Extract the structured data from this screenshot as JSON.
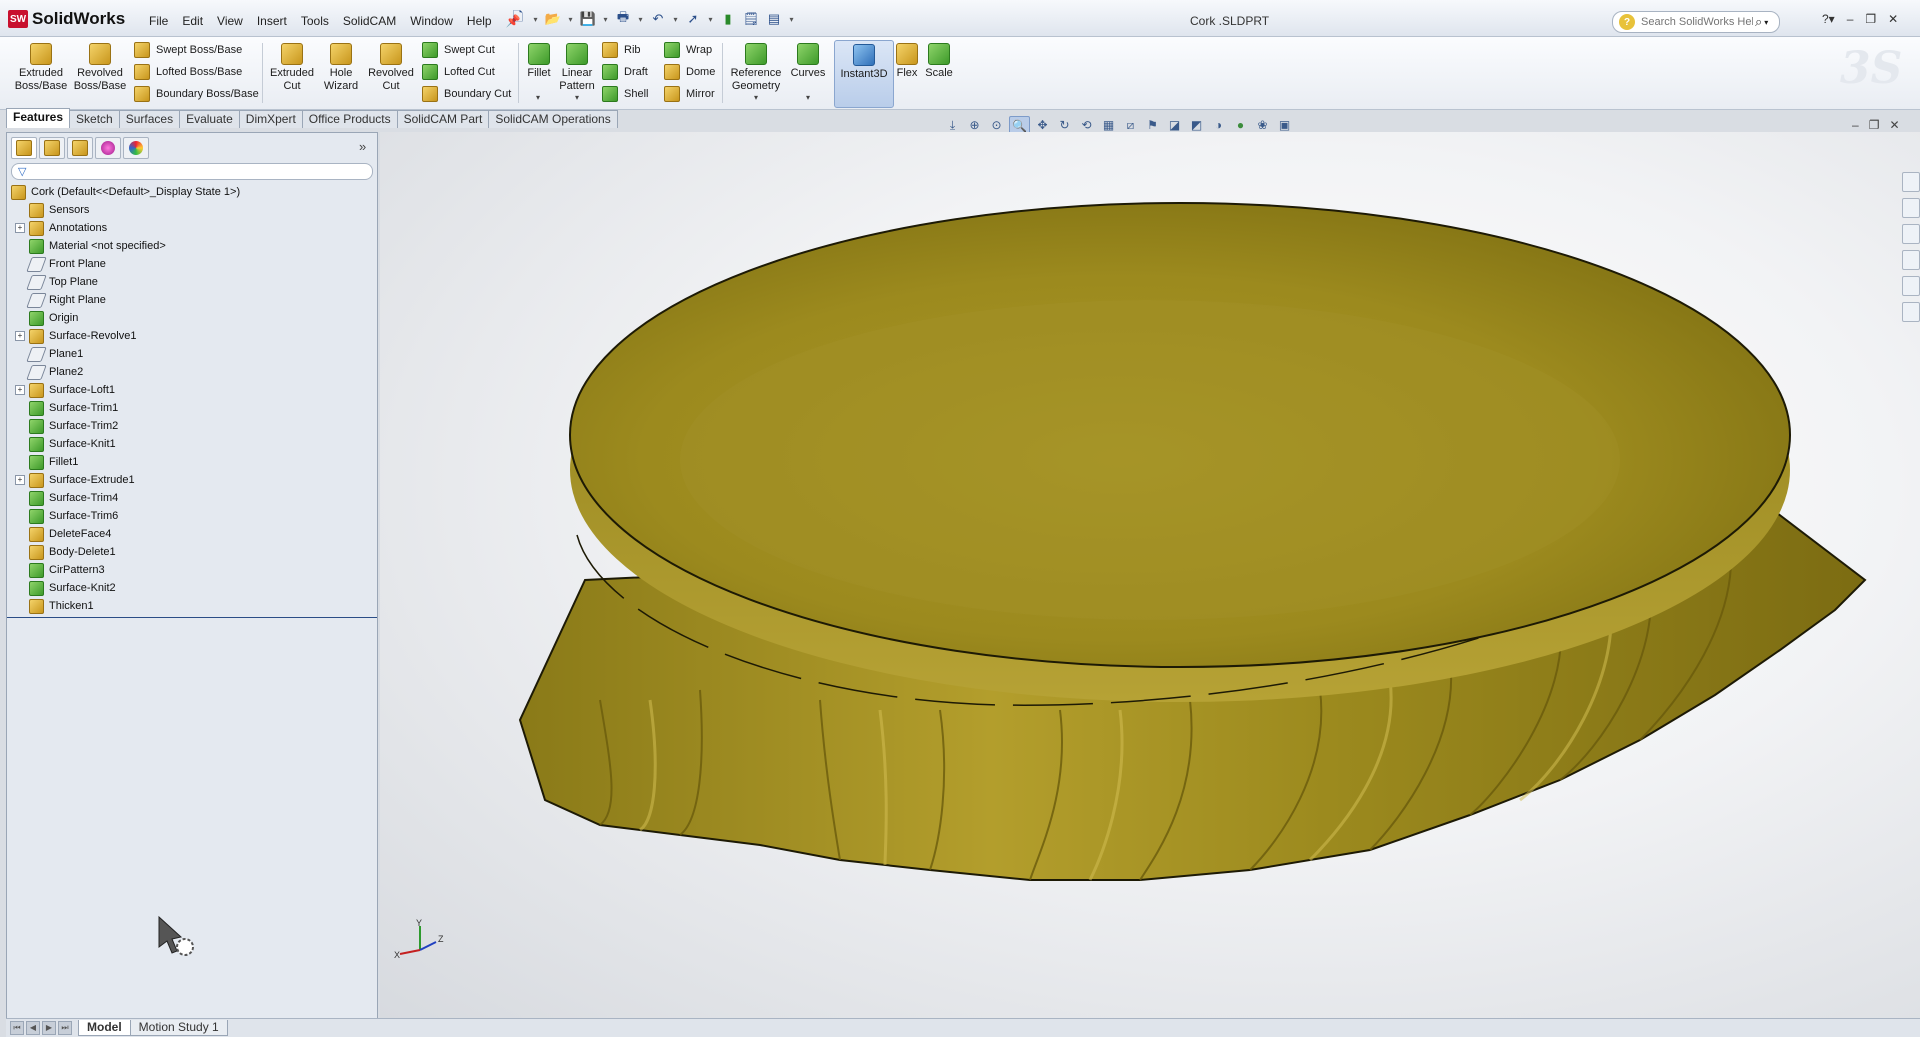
{
  "app": {
    "brand": "SolidWorks",
    "brand_logo": "SW",
    "document_title": "Cork .SLDPRT"
  },
  "menu": [
    "File",
    "Edit",
    "View",
    "Insert",
    "Tools",
    "SolidCAM",
    "Window",
    "Help"
  ],
  "search": {
    "placeholder": "Search SolidWorks Help"
  },
  "toolbar": {
    "extruded_boss": "Extruded Boss/Base",
    "revolved_boss": "Revolved Boss/Base",
    "swept_boss": "Swept Boss/Base",
    "lofted_boss": "Lofted Boss/Base",
    "boundary_boss": "Boundary Boss/Base",
    "extruded_cut": "Extruded Cut",
    "hole_wizard": "Hole Wizard",
    "revolved_cut": "Revolved Cut",
    "swept_cut": "Swept Cut",
    "lofted_cut": "Lofted Cut",
    "boundary_cut": "Boundary Cut",
    "fillet": "Fillet",
    "linear_pattern": "Linear Pattern",
    "rib": "Rib",
    "draft": "Draft",
    "shell": "Shell",
    "wrap": "Wrap",
    "dome": "Dome",
    "mirror": "Mirror",
    "reference_geometry": "Reference Geometry",
    "curves": "Curves",
    "instant3d": "Instant3D",
    "flex": "Flex",
    "scale": "Scale"
  },
  "tabs": [
    "Features",
    "Sketch",
    "Surfaces",
    "Evaluate",
    "DimXpert",
    "Office Products",
    "SolidCAM Part",
    "SolidCAM Operations"
  ],
  "tree": {
    "root": "Cork  (Default<<Default>_Display State 1>)",
    "items": [
      {
        "label": "Sensors",
        "expandable": false,
        "icon": "sensor-icon"
      },
      {
        "label": "Annotations",
        "expandable": true,
        "icon": "annotation-icon"
      },
      {
        "label": "Material <not specified>",
        "expandable": false,
        "icon": "material-icon"
      },
      {
        "label": "Front Plane",
        "expandable": false,
        "icon": "plane-icon"
      },
      {
        "label": "Top Plane",
        "expandable": false,
        "icon": "plane-icon"
      },
      {
        "label": "Right Plane",
        "expandable": false,
        "icon": "plane-icon"
      },
      {
        "label": "Origin",
        "expandable": false,
        "icon": "origin-icon"
      },
      {
        "label": "Surface-Revolve1",
        "expandable": true,
        "icon": "surface-revolve-icon"
      },
      {
        "label": "Plane1",
        "expandable": false,
        "icon": "plane-icon"
      },
      {
        "label": "Plane2",
        "expandable": false,
        "icon": "plane-icon"
      },
      {
        "label": "Surface-Loft1",
        "expandable": true,
        "icon": "surface-loft-icon"
      },
      {
        "label": "Surface-Trim1",
        "expandable": false,
        "icon": "surface-trim-icon"
      },
      {
        "label": "Surface-Trim2",
        "expandable": false,
        "icon": "surface-trim-icon"
      },
      {
        "label": "Surface-Knit1",
        "expandable": false,
        "icon": "surface-knit-icon"
      },
      {
        "label": "Fillet1",
        "expandable": false,
        "icon": "fillet-icon"
      },
      {
        "label": "Surface-Extrude1",
        "expandable": true,
        "icon": "surface-extrude-icon"
      },
      {
        "label": "Surface-Trim4",
        "expandable": false,
        "icon": "surface-trim-icon"
      },
      {
        "label": "Surface-Trim6",
        "expandable": false,
        "icon": "surface-trim-icon"
      },
      {
        "label": "DeleteFace4",
        "expandable": false,
        "icon": "delete-face-icon"
      },
      {
        "label": "Body-Delete1",
        "expandable": false,
        "icon": "body-delete-icon"
      },
      {
        "label": "CirPattern3",
        "expandable": false,
        "icon": "circular-pattern-icon"
      },
      {
        "label": "Surface-Knit2",
        "expandable": false,
        "icon": "surface-knit-icon"
      },
      {
        "label": "Thicken1",
        "expandable": false,
        "icon": "thicken-icon"
      }
    ]
  },
  "bottom_tabs": [
    "Model",
    "Motion Study 1"
  ],
  "triad": {
    "x": "X",
    "y": "Y",
    "z": "Z"
  },
  "colors": {
    "model_gold": "#9c8a1e",
    "selection_blue": "#b9cce8",
    "brand_red": "#c8102e"
  }
}
